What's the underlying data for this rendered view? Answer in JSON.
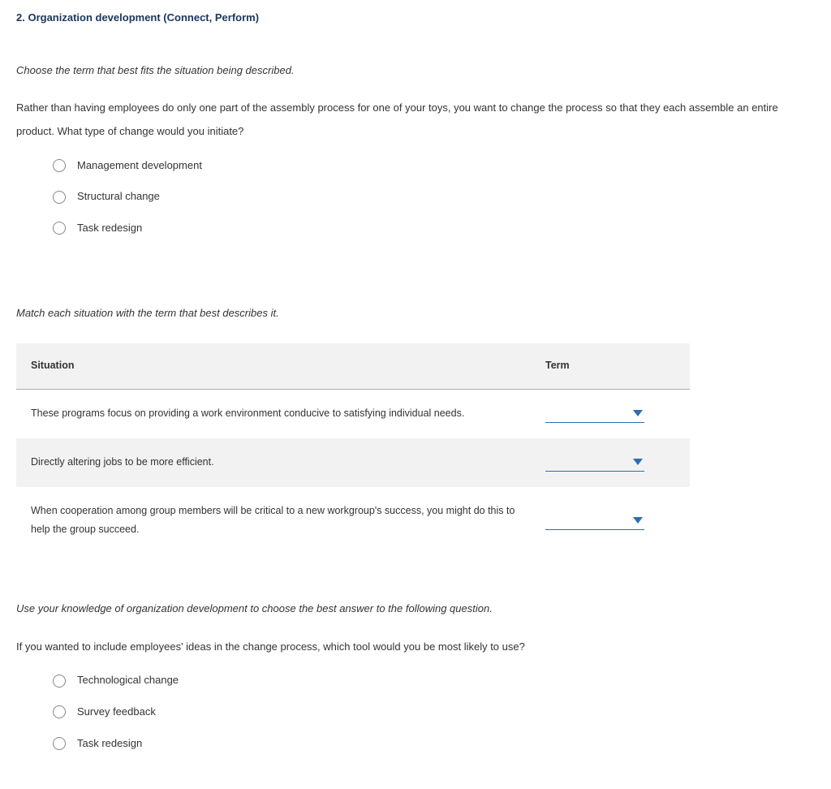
{
  "title": "2. Organization development (Connect, Perform)",
  "q1": {
    "instruction": "Choose the term that best fits the situation being described.",
    "stem": "Rather than having employees do only one part of the assembly process for one of your toys, you want to change the process so that they each assemble an entire product. What type of change would you initiate?",
    "options": {
      "a": "Management development",
      "b": "Structural change",
      "c": "Task redesign"
    }
  },
  "match": {
    "instruction": "Match each situation with the term that best describes it.",
    "headers": {
      "situation": "Situation",
      "term": "Term"
    },
    "rows": {
      "r0": "These programs focus on providing a work environment conducive to satisfying individual needs.",
      "r1": "Directly altering jobs to be more efficient.",
      "r2": "When cooperation among group members will be critical to a new workgroup's success, you might do this to help the group succeed."
    }
  },
  "q2": {
    "instruction": "Use your knowledge of organization development to choose the best answer to the following question.",
    "stem": "If you wanted to include employees' ideas in the change process, which tool would you be most likely to use?",
    "options": {
      "a": "Technological change",
      "b": "Survey feedback",
      "c": "Task redesign"
    }
  }
}
